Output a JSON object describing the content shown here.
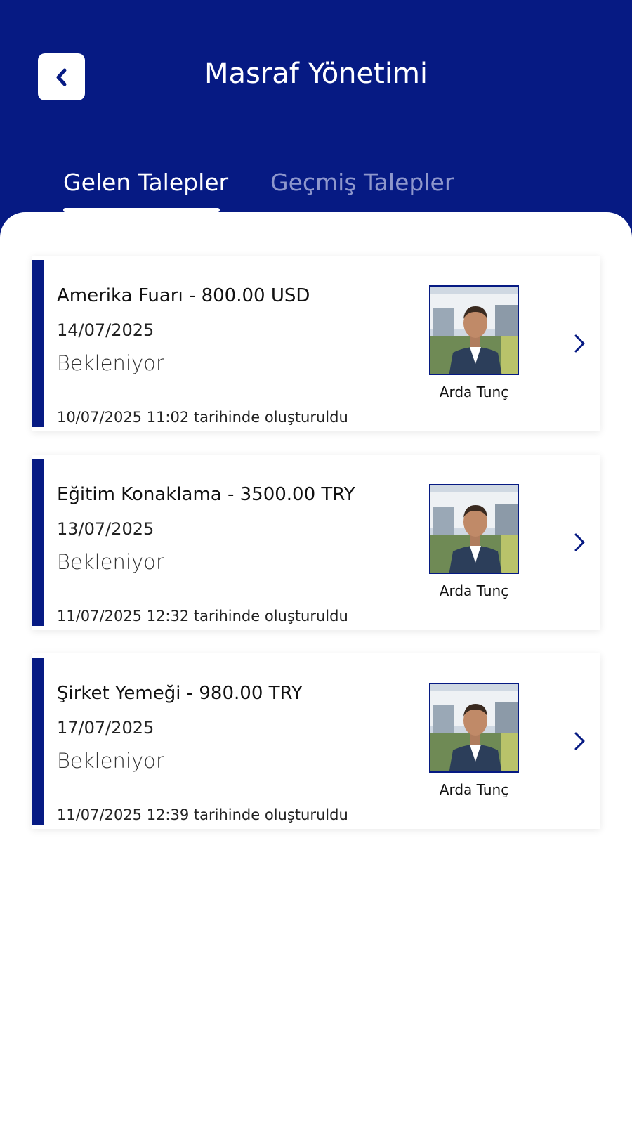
{
  "header": {
    "title": "Masraf Yönetimi",
    "back_icon": "chevron-left-icon"
  },
  "tabs": [
    {
      "label": "Gelen Talepler",
      "active": true
    },
    {
      "label": "Geçmiş Talepler",
      "active": false
    }
  ],
  "requests": [
    {
      "title": "Amerika Fuarı - 800.00 USD",
      "date": "14/07/2025",
      "status": "Bekleniyor",
      "created": "10/07/2025  11:02 tarihinde oluşturuldu",
      "person": "Arda Tunç"
    },
    {
      "title": "Eğitim Konaklama - 3500.00 TRY",
      "date": "13/07/2025",
      "status": "Bekleniyor",
      "created": "11/07/2025  12:32 tarihinde oluşturuldu",
      "person": "Arda Tunç"
    },
    {
      "title": "Şirket Yemeği - 980.00 TRY",
      "date": "17/07/2025",
      "status": "Bekleniyor",
      "created": "11/07/2025  12:39 tarihinde oluşturuldu",
      "person": "Arda Tunç"
    }
  ],
  "colors": {
    "primary": "#061a83",
    "tab_inactive": "#8e97cc",
    "background": "#ffffff"
  }
}
